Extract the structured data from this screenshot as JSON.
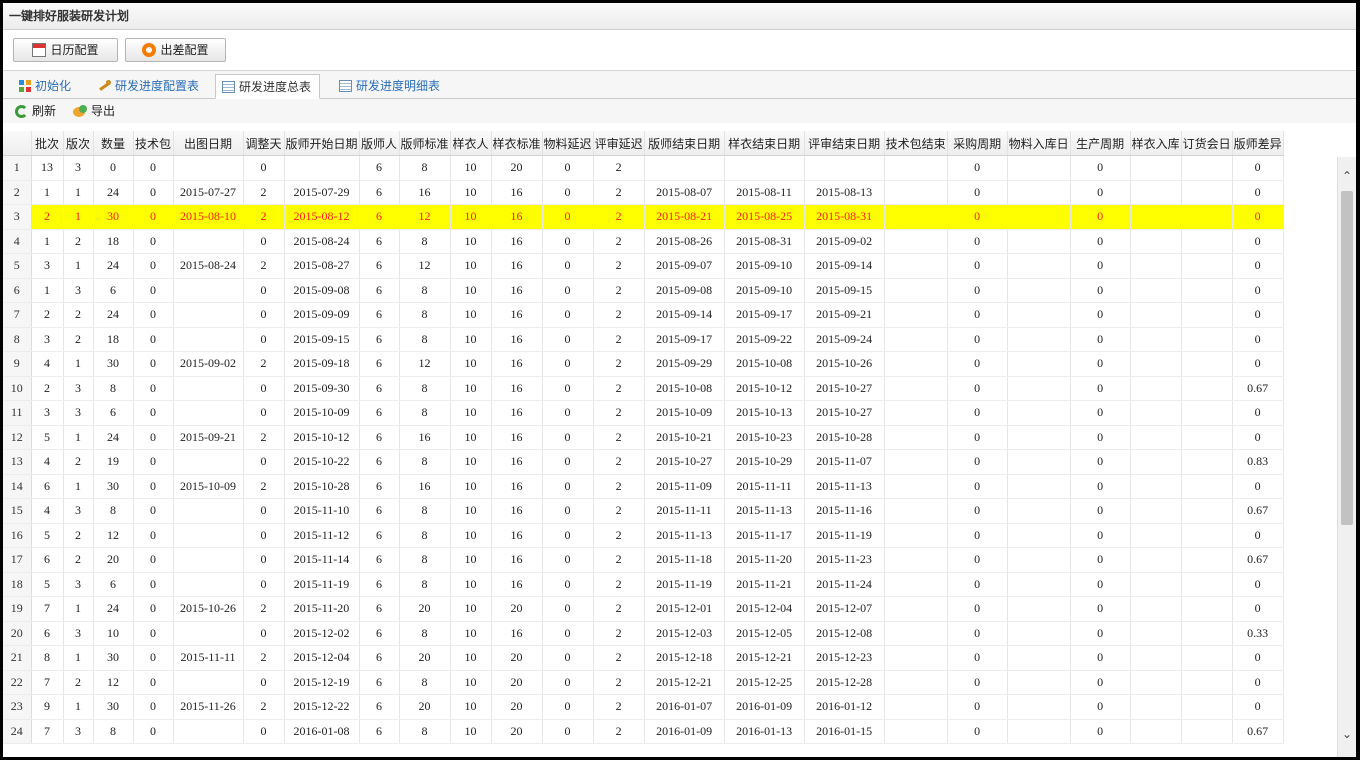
{
  "window": {
    "title": "一键排好服装研发计划"
  },
  "toolbar": {
    "calendar_label": "日历配置",
    "travel_label": "出差配置"
  },
  "tabs": [
    {
      "label": "初始化",
      "icon": "grid-icon"
    },
    {
      "label": "研发进度配置表",
      "icon": "wrench-icon"
    },
    {
      "label": "研发进度总表",
      "icon": "table-icon",
      "active": true
    },
    {
      "label": "研发进度明细表",
      "icon": "table-icon"
    }
  ],
  "actions": {
    "refresh_label": "刷新",
    "export_label": "导出"
  },
  "table": {
    "columns": [
      "批次",
      "版次",
      "数量",
      "技术包",
      "出图日期",
      "调整天",
      "版师开始日期",
      "版师人",
      "版师标准",
      "样衣人",
      "样衣标准",
      "物料延迟",
      "评审延迟",
      "版师结束日期",
      "样衣结束日期",
      "评审结束日期",
      "技术包结束",
      "采购周期",
      "物料入库日",
      "生产周期",
      "样衣入库",
      "订货会日",
      "版师差异"
    ],
    "highlight_row": 3,
    "rows": [
      [
        "1",
        "13",
        "3",
        "0",
        "0",
        "",
        "0",
        "",
        "6",
        "8",
        "10",
        "20",
        "0",
        "2",
        "",
        "",
        "",
        "",
        "0",
        "",
        "0",
        "",
        "",
        "0"
      ],
      [
        "2",
        "1",
        "1",
        "24",
        "0",
        "2015-07-27",
        "2",
        "2015-07-29",
        "6",
        "16",
        "10",
        "16",
        "0",
        "2",
        "2015-08-07",
        "2015-08-11",
        "2015-08-13",
        "",
        "0",
        "",
        "0",
        "",
        "",
        "0"
      ],
      [
        "3",
        "2",
        "1",
        "30",
        "0",
        "2015-08-10",
        "2",
        "2015-08-12",
        "6",
        "12",
        "10",
        "16",
        "0",
        "2",
        "2015-08-21",
        "2015-08-25",
        "2015-08-31",
        "",
        "0",
        "",
        "0",
        "",
        "",
        "0"
      ],
      [
        "4",
        "1",
        "2",
        "18",
        "0",
        "",
        "0",
        "2015-08-24",
        "6",
        "8",
        "10",
        "16",
        "0",
        "2",
        "2015-08-26",
        "2015-08-31",
        "2015-09-02",
        "",
        "0",
        "",
        "0",
        "",
        "",
        "0"
      ],
      [
        "5",
        "3",
        "1",
        "24",
        "0",
        "2015-08-24",
        "2",
        "2015-08-27",
        "6",
        "12",
        "10",
        "16",
        "0",
        "2",
        "2015-09-07",
        "2015-09-10",
        "2015-09-14",
        "",
        "0",
        "",
        "0",
        "",
        "",
        "0"
      ],
      [
        "6",
        "1",
        "3",
        "6",
        "0",
        "",
        "0",
        "2015-09-08",
        "6",
        "8",
        "10",
        "16",
        "0",
        "2",
        "2015-09-08",
        "2015-09-10",
        "2015-09-15",
        "",
        "0",
        "",
        "0",
        "",
        "",
        "0"
      ],
      [
        "7",
        "2",
        "2",
        "24",
        "0",
        "",
        "0",
        "2015-09-09",
        "6",
        "8",
        "10",
        "16",
        "0",
        "2",
        "2015-09-14",
        "2015-09-17",
        "2015-09-21",
        "",
        "0",
        "",
        "0",
        "",
        "",
        "0"
      ],
      [
        "8",
        "3",
        "2",
        "18",
        "0",
        "",
        "0",
        "2015-09-15",
        "6",
        "8",
        "10",
        "16",
        "0",
        "2",
        "2015-09-17",
        "2015-09-22",
        "2015-09-24",
        "",
        "0",
        "",
        "0",
        "",
        "",
        "0"
      ],
      [
        "9",
        "4",
        "1",
        "30",
        "0",
        "2015-09-02",
        "2",
        "2015-09-18",
        "6",
        "12",
        "10",
        "16",
        "0",
        "2",
        "2015-09-29",
        "2015-10-08",
        "2015-10-26",
        "",
        "0",
        "",
        "0",
        "",
        "",
        "0"
      ],
      [
        "10",
        "2",
        "3",
        "8",
        "0",
        "",
        "0",
        "2015-09-30",
        "6",
        "8",
        "10",
        "16",
        "0",
        "2",
        "2015-10-08",
        "2015-10-12",
        "2015-10-27",
        "",
        "0",
        "",
        "0",
        "",
        "",
        "0.67"
      ],
      [
        "11",
        "3",
        "3",
        "6",
        "0",
        "",
        "0",
        "2015-10-09",
        "6",
        "8",
        "10",
        "16",
        "0",
        "2",
        "2015-10-09",
        "2015-10-13",
        "2015-10-27",
        "",
        "0",
        "",
        "0",
        "",
        "",
        "0"
      ],
      [
        "12",
        "5",
        "1",
        "24",
        "0",
        "2015-09-21",
        "2",
        "2015-10-12",
        "6",
        "16",
        "10",
        "16",
        "0",
        "2",
        "2015-10-21",
        "2015-10-23",
        "2015-10-28",
        "",
        "0",
        "",
        "0",
        "",
        "",
        "0"
      ],
      [
        "13",
        "4",
        "2",
        "19",
        "0",
        "",
        "0",
        "2015-10-22",
        "6",
        "8",
        "10",
        "16",
        "0",
        "2",
        "2015-10-27",
        "2015-10-29",
        "2015-11-07",
        "",
        "0",
        "",
        "0",
        "",
        "",
        "0.83"
      ],
      [
        "14",
        "6",
        "1",
        "30",
        "0",
        "2015-10-09",
        "2",
        "2015-10-28",
        "6",
        "16",
        "10",
        "16",
        "0",
        "2",
        "2015-11-09",
        "2015-11-11",
        "2015-11-13",
        "",
        "0",
        "",
        "0",
        "",
        "",
        "0"
      ],
      [
        "15",
        "4",
        "3",
        "8",
        "0",
        "",
        "0",
        "2015-11-10",
        "6",
        "8",
        "10",
        "16",
        "0",
        "2",
        "2015-11-11",
        "2015-11-13",
        "2015-11-16",
        "",
        "0",
        "",
        "0",
        "",
        "",
        "0.67"
      ],
      [
        "16",
        "5",
        "2",
        "12",
        "0",
        "",
        "0",
        "2015-11-12",
        "6",
        "8",
        "10",
        "16",
        "0",
        "2",
        "2015-11-13",
        "2015-11-17",
        "2015-11-19",
        "",
        "0",
        "",
        "0",
        "",
        "",
        "0"
      ],
      [
        "17",
        "6",
        "2",
        "20",
        "0",
        "",
        "0",
        "2015-11-14",
        "6",
        "8",
        "10",
        "16",
        "0",
        "2",
        "2015-11-18",
        "2015-11-20",
        "2015-11-23",
        "",
        "0",
        "",
        "0",
        "",
        "",
        "0.67"
      ],
      [
        "18",
        "5",
        "3",
        "6",
        "0",
        "",
        "0",
        "2015-11-19",
        "6",
        "8",
        "10",
        "16",
        "0",
        "2",
        "2015-11-19",
        "2015-11-21",
        "2015-11-24",
        "",
        "0",
        "",
        "0",
        "",
        "",
        "0"
      ],
      [
        "19",
        "7",
        "1",
        "24",
        "0",
        "2015-10-26",
        "2",
        "2015-11-20",
        "6",
        "20",
        "10",
        "20",
        "0",
        "2",
        "2015-12-01",
        "2015-12-04",
        "2015-12-07",
        "",
        "0",
        "",
        "0",
        "",
        "",
        "0"
      ],
      [
        "20",
        "6",
        "3",
        "10",
        "0",
        "",
        "0",
        "2015-12-02",
        "6",
        "8",
        "10",
        "16",
        "0",
        "2",
        "2015-12-03",
        "2015-12-05",
        "2015-12-08",
        "",
        "0",
        "",
        "0",
        "",
        "",
        "0.33"
      ],
      [
        "21",
        "8",
        "1",
        "30",
        "0",
        "2015-11-11",
        "2",
        "2015-12-04",
        "6",
        "20",
        "10",
        "20",
        "0",
        "2",
        "2015-12-18",
        "2015-12-21",
        "2015-12-23",
        "",
        "0",
        "",
        "0",
        "",
        "",
        "0"
      ],
      [
        "22",
        "7",
        "2",
        "12",
        "0",
        "",
        "0",
        "2015-12-19",
        "6",
        "8",
        "10",
        "20",
        "0",
        "2",
        "2015-12-21",
        "2015-12-25",
        "2015-12-28",
        "",
        "0",
        "",
        "0",
        "",
        "",
        "0"
      ],
      [
        "23",
        "9",
        "1",
        "30",
        "0",
        "2015-11-26",
        "2",
        "2015-12-22",
        "6",
        "20",
        "10",
        "20",
        "0",
        "2",
        "2016-01-07",
        "2016-01-09",
        "2016-01-12",
        "",
        "0",
        "",
        "0",
        "",
        "",
        "0"
      ],
      [
        "24",
        "7",
        "3",
        "8",
        "0",
        "",
        "0",
        "2016-01-08",
        "6",
        "8",
        "10",
        "20",
        "0",
        "2",
        "2016-01-09",
        "2016-01-13",
        "2016-01-15",
        "",
        "0",
        "",
        "0",
        "",
        "",
        "0.67"
      ]
    ]
  }
}
